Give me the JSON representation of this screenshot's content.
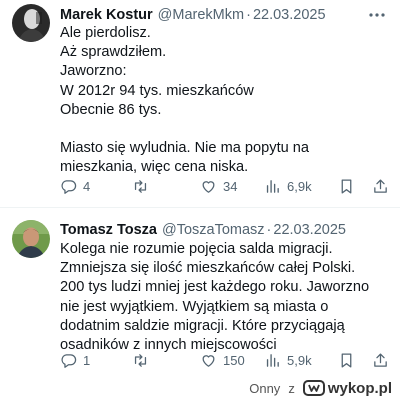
{
  "tweets": [
    {
      "name": "Marek Kostur",
      "handle": "@MarekMkm",
      "separator": "·",
      "date": "22.03.2025",
      "lines": [
        "Ale pierdolisz.",
        "Aż sprawdziłem.",
        "Jaworzno:",
        "W 2012r 94 tys. mieszkańców",
        "Obecnie 86 tys.",
        "",
        "Miasto się wyludnia. Nie ma popytu na",
        "mieszkania, więc cena niska."
      ],
      "replies": "4",
      "retweets": "",
      "likes": "34",
      "views": "6,9k"
    },
    {
      "name": "Tomasz Tosza",
      "handle": "@ToszaTomasz",
      "separator": "·",
      "date": "22.03.2025",
      "lines": [
        "Kolega nie rozumie pojęcia salda migracji.",
        "Zmniejsza się ilość mieszkańców całej Polski.",
        "200 tys ludzi mniej jest każdego roku. Jaworzno",
        "nie jest wyjątkiem. Wyjątkiem są miasta o",
        "dodatnim saldzie migracji. Które przyciągają",
        "osadników z innych miejscowości"
      ],
      "replies": "1",
      "retweets": "",
      "likes": "150",
      "views": "5,9k"
    }
  ],
  "watermark": {
    "user": "Onny",
    "connector": "z",
    "brand": "wykop.pl"
  },
  "colors": {
    "text": "#0f1419",
    "muted": "#536471",
    "border": "#eff3f4",
    "wykop_blue": "#367aa9",
    "wykop_orange": "#f4b631"
  },
  "icons": [
    "more-icon",
    "reply-icon",
    "retweet-icon",
    "like-icon",
    "views-icon",
    "bookmark-icon",
    "share-icon"
  ]
}
